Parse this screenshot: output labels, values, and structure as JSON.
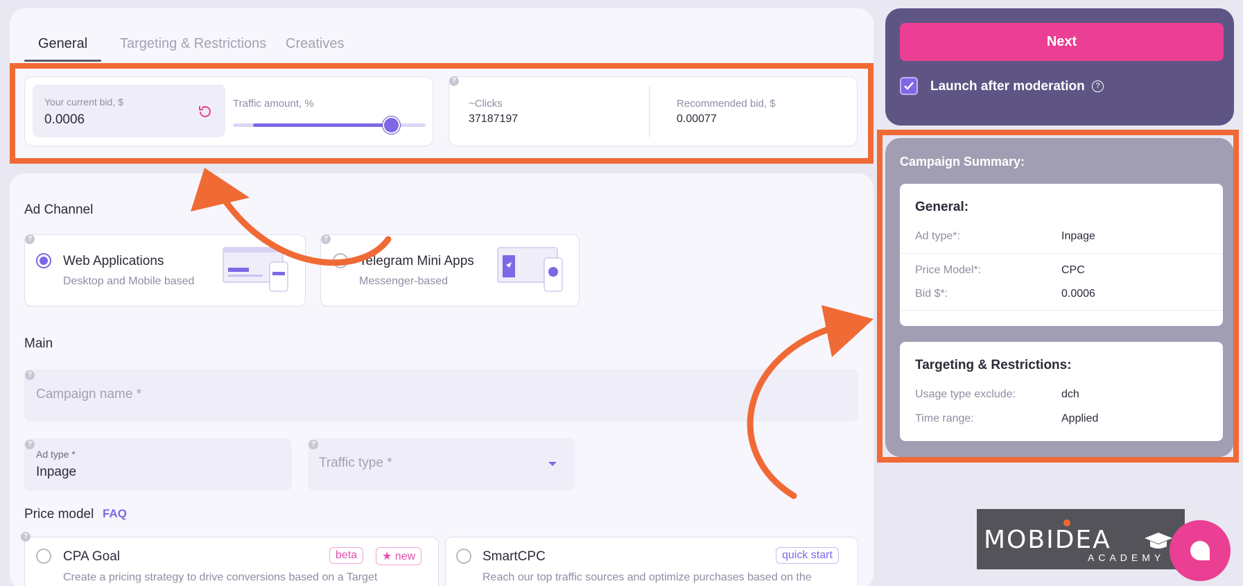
{
  "tabs": [
    {
      "label": "General",
      "active": true
    },
    {
      "label": "Targeting & Restrictions",
      "active": false
    },
    {
      "label": "Creatives",
      "active": false
    }
  ],
  "bid": {
    "current_label": "Your current bid, $",
    "current_value": "0.0006",
    "traffic_label": "Traffic amount, %",
    "traffic_fraction": 0.82
  },
  "stats": {
    "clicks_label": "~Clicks",
    "clicks_value": "37187197",
    "rec_label": "Recommended bid, $",
    "rec_value": "0.00077"
  },
  "ad_channel": {
    "heading": "Ad Channel",
    "options": [
      {
        "title": "Web Applications",
        "subtitle": "Desktop and Mobile based",
        "selected": true
      },
      {
        "title": "Telegram Mini Apps",
        "subtitle": "Messenger-based",
        "selected": false
      }
    ]
  },
  "main": {
    "heading": "Main",
    "campaign_name_placeholder": "Campaign name *",
    "ad_type_label": "Ad type *",
    "ad_type_value": "Inpage",
    "traffic_type_placeholder": "Traffic type *"
  },
  "price_model": {
    "heading": "Price model",
    "faq_link": "FAQ",
    "options": [
      {
        "title": "CPA Goal",
        "badges": [
          "beta",
          "★ new"
        ],
        "desc": "Create a pricing strategy to drive conversions based on a Target"
      },
      {
        "title": "SmartCPC",
        "badges": [
          "quick start"
        ],
        "desc": "Reach our top traffic sources and optimize purchases based on the"
      }
    ]
  },
  "sidebar": {
    "next_label": "Next",
    "launch_label": "Launch after moderation",
    "launch_checked": true,
    "summary_title": "Campaign Summary:",
    "general": {
      "heading": "General:",
      "rows": [
        {
          "k": "Ad type*:",
          "v": "Inpage"
        },
        {
          "k": "Price Model*:",
          "v": "CPC"
        },
        {
          "k": "Bid $*:",
          "v": "0.0006"
        }
      ]
    },
    "targeting": {
      "heading": "Targeting & Restrictions:",
      "rows": [
        {
          "k": "Usage type exclude:",
          "v": "dch"
        },
        {
          "k": "Time range:",
          "v": "Applied"
        }
      ]
    }
  },
  "logo": {
    "main": "MOBIDEA",
    "sub": "ACADEMY"
  },
  "colors": {
    "accent": "#7f67e6",
    "pink": "#ea3f93",
    "annotation": "#f06a35",
    "sidebar_dark": "#5f5585"
  },
  "icons": [
    "reset-icon",
    "question-icon",
    "chevron-down-icon",
    "checkmark-icon",
    "chat-icon",
    "graduation-cap-icon"
  ]
}
